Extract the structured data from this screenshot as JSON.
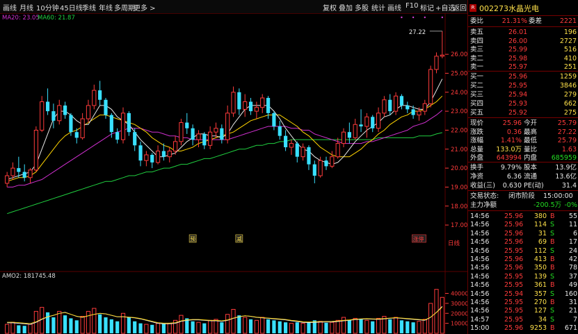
{
  "toolbar": {
    "left": [
      "画线",
      "月线",
      "10分钟",
      "45日线",
      "季线",
      "年线",
      "多周期",
      "更多 >"
    ],
    "right": [
      "复权",
      "叠加",
      "多股",
      "统计",
      "画线",
      "F10",
      "标记",
      "+自选",
      "返回"
    ]
  },
  "indicators": {
    "ma20": "MA20: 23.05",
    "ma60": "MA60: 21.87",
    "vol": "AMO2: 181745.48"
  },
  "price_axis": [
    "26.00",
    "25.00",
    "24.00",
    "23.00",
    "22.00",
    "21.00",
    "20.00",
    "19.00",
    "18.00",
    "17.00"
  ],
  "vol_axis": [
    "40000",
    "30000",
    "20000",
    "10000"
  ],
  "axis_label": "日线",
  "high_label": "27.22",
  "markers": [
    {
      "t": "预",
      "col": "#ffe14a"
    },
    {
      "t": "减",
      "col": "#ffe14a"
    },
    {
      "t": "涨停",
      "col": "#ff3b3b"
    }
  ],
  "chart_data": {
    "type": "candlestick",
    "y_range": [
      16.6,
      27.8
    ],
    "candles": [
      [
        19.2,
        19.8,
        19.0,
        19.6
      ],
      [
        19.6,
        20.3,
        19.4,
        20.0
      ],
      [
        20.0,
        20.6,
        19.5,
        19.8
      ],
      [
        19.8,
        20.2,
        19.3,
        19.5
      ],
      [
        19.5,
        20.0,
        19.2,
        19.9
      ],
      [
        19.9,
        22.2,
        19.8,
        22.0
      ],
      [
        22.0,
        23.8,
        21.9,
        23.5
      ],
      [
        23.5,
        24.2,
        22.8,
        23.0
      ],
      [
        23.0,
        23.4,
        22.1,
        22.5
      ],
      [
        22.5,
        23.6,
        22.3,
        23.3
      ],
      [
        23.3,
        23.5,
        22.6,
        22.8
      ],
      [
        22.8,
        22.9,
        21.7,
        21.9
      ],
      [
        21.9,
        22.1,
        21.3,
        21.6
      ],
      [
        21.6,
        22.9,
        21.5,
        22.6
      ],
      [
        22.6,
        23.6,
        22.4,
        23.3
      ],
      [
        23.3,
        24.4,
        23.1,
        24.1
      ],
      [
        24.1,
        24.6,
        23.3,
        23.6
      ],
      [
        23.6,
        23.7,
        22.6,
        22.8
      ],
      [
        22.8,
        22.9,
        21.6,
        21.9
      ],
      [
        21.9,
        22.1,
        21.3,
        21.5
      ],
      [
        21.5,
        23.2,
        21.3,
        22.9
      ],
      [
        22.9,
        23.0,
        21.7,
        21.9
      ],
      [
        21.9,
        22.1,
        20.9,
        21.2
      ],
      [
        21.2,
        21.4,
        20.1,
        20.4
      ],
      [
        20.4,
        20.9,
        20.1,
        20.7
      ],
      [
        20.7,
        20.8,
        20.0,
        20.3
      ],
      [
        20.3,
        21.2,
        20.2,
        20.9
      ],
      [
        20.9,
        21.3,
        20.4,
        20.6
      ],
      [
        20.6,
        21.1,
        20.3,
        20.9
      ],
      [
        20.9,
        21.7,
        20.7,
        21.4
      ],
      [
        21.4,
        22.6,
        21.2,
        22.4
      ],
      [
        22.4,
        22.9,
        21.8,
        22.1
      ],
      [
        22.1,
        22.3,
        21.2,
        21.5
      ],
      [
        21.5,
        22.0,
        21.1,
        21.8
      ],
      [
        21.8,
        21.9,
        21.0,
        21.2
      ],
      [
        21.2,
        22.2,
        21.0,
        21.9
      ],
      [
        21.9,
        22.4,
        21.6,
        22.1
      ],
      [
        22.1,
        22.3,
        21.3,
        21.5
      ],
      [
        21.5,
        23.3,
        21.3,
        22.9
      ],
      [
        22.9,
        24.3,
        22.7,
        24.0
      ],
      [
        24.0,
        24.2,
        22.8,
        23.1
      ],
      [
        23.1,
        23.9,
        22.7,
        23.5
      ],
      [
        23.5,
        23.7,
        22.8,
        23.0
      ],
      [
        23.0,
        23.5,
        22.6,
        23.2
      ],
      [
        23.2,
        23.9,
        22.9,
        23.7
      ],
      [
        23.7,
        23.8,
        22.6,
        22.9
      ],
      [
        22.9,
        23.0,
        22.0,
        22.2
      ],
      [
        22.2,
        22.5,
        21.5,
        21.7
      ],
      [
        21.7,
        22.0,
        20.9,
        21.1
      ],
      [
        21.1,
        21.5,
        20.7,
        21.3
      ],
      [
        21.3,
        21.4,
        20.3,
        20.6
      ],
      [
        20.6,
        21.3,
        20.4,
        21.1
      ],
      [
        21.1,
        21.2,
        19.9,
        20.2
      ],
      [
        20.2,
        20.4,
        19.2,
        19.6
      ],
      [
        19.6,
        20.6,
        19.5,
        20.4
      ],
      [
        20.4,
        20.6,
        19.9,
        20.1
      ],
      [
        20.1,
        20.9,
        20.0,
        20.6
      ],
      [
        20.6,
        21.6,
        20.5,
        21.3
      ],
      [
        21.3,
        22.1,
        21.1,
        21.9
      ],
      [
        21.9,
        22.4,
        21.3,
        21.6
      ],
      [
        21.6,
        22.6,
        21.5,
        22.3
      ],
      [
        22.3,
        23.1,
        21.9,
        22.2
      ],
      [
        22.2,
        22.9,
        21.6,
        22.7
      ],
      [
        22.7,
        22.8,
        21.9,
        22.1
      ],
      [
        22.1,
        23.2,
        21.9,
        22.9
      ],
      [
        22.9,
        23.8,
        22.7,
        23.6
      ],
      [
        23.6,
        23.9,
        22.8,
        23.0
      ],
      [
        23.0,
        24.0,
        22.8,
        23.8
      ],
      [
        23.8,
        23.9,
        23.1,
        23.3
      ],
      [
        23.3,
        23.5,
        22.9,
        23.1
      ],
      [
        23.1,
        23.3,
        22.6,
        22.8
      ],
      [
        22.8,
        23.2,
        22.5,
        23.0
      ],
      [
        23.0,
        23.6,
        22.8,
        23.4
      ],
      [
        23.4,
        25.4,
        23.2,
        25.2
      ],
      [
        25.2,
        26.1,
        25.0,
        25.9
      ],
      [
        25.9,
        27.22,
        25.79,
        25.96
      ]
    ],
    "ma_lines": {
      "ma5": [
        19.4,
        19.5,
        19.6,
        19.7,
        19.8,
        20.2,
        21.0,
        21.8,
        22.6,
        23.0,
        23.0,
        22.8,
        22.5,
        22.3,
        22.3,
        22.8,
        23.3,
        23.3,
        23.1,
        22.7,
        22.5,
        22.3,
        21.9,
        21.5,
        21.2,
        20.9,
        20.6,
        20.6,
        20.7,
        20.8,
        21.1,
        21.4,
        21.6,
        21.8,
        21.8,
        21.7,
        21.7,
        21.6,
        21.8,
        22.3,
        22.7,
        23.1,
        23.3,
        23.3,
        23.3,
        23.3,
        23.0,
        22.6,
        22.1,
        21.7,
        21.3,
        21.0,
        20.9,
        20.6,
        20.4,
        20.3,
        20.2,
        20.3,
        20.6,
        21.0,
        21.4,
        21.7,
        22.0,
        22.2,
        22.4,
        22.7,
        22.8,
        23.1,
        23.3,
        23.3,
        23.2,
        23.1,
        23.1,
        23.5,
        24.1,
        24.7
      ],
      "ma10": [
        19.3,
        19.4,
        19.5,
        19.5,
        19.6,
        19.8,
        20.2,
        20.6,
        21.0,
        21.4,
        21.7,
        21.9,
        22.0,
        22.2,
        22.4,
        22.6,
        22.8,
        22.8,
        22.7,
        22.6,
        22.5,
        22.4,
        22.3,
        22.1,
        21.9,
        21.6,
        21.4,
        21.2,
        21.1,
        20.9,
        20.9,
        21.0,
        21.1,
        21.3,
        21.4,
        21.5,
        21.6,
        21.7,
        21.8,
        21.9,
        22.1,
        22.3,
        22.5,
        22.6,
        22.7,
        22.8,
        22.8,
        22.8,
        22.6,
        22.4,
        22.2,
        21.9,
        21.7,
        21.4,
        21.1,
        20.9,
        20.7,
        20.6,
        20.6,
        20.6,
        20.8,
        21.0,
        21.3,
        21.5,
        21.8,
        22.0,
        22.3,
        22.5,
        22.7,
        22.8,
        23.0,
        23.0,
        23.1,
        23.3,
        23.5,
        23.8
      ],
      "ma20": [
        19.0,
        19.0,
        19.1,
        19.1,
        19.2,
        19.3,
        19.4,
        19.6,
        19.8,
        20.0,
        20.2,
        20.4,
        20.6,
        20.8,
        21.0,
        21.2,
        21.4,
        21.6,
        21.8,
        21.9,
        22.0,
        22.1,
        22.1,
        22.1,
        22.0,
        21.9,
        21.9,
        21.8,
        21.7,
        21.7,
        21.6,
        21.6,
        21.5,
        21.5,
        21.5,
        21.5,
        21.5,
        21.5,
        21.5,
        21.6,
        21.7,
        21.8,
        21.9,
        22.0,
        22.1,
        22.2,
        22.2,
        22.2,
        22.2,
        22.1,
        22.1,
        22.0,
        22.0,
        21.8,
        21.7,
        21.6,
        21.5,
        21.4,
        21.3,
        21.3,
        21.3,
        21.3,
        21.4,
        21.4,
        21.5,
        21.6,
        21.7,
        21.8,
        21.9,
        22.0,
        22.2,
        22.3,
        22.4,
        22.6,
        22.8,
        23.05
      ],
      "ma60": [
        17.6,
        17.7,
        17.8,
        17.9,
        18.0,
        18.1,
        18.2,
        18.3,
        18.4,
        18.5,
        18.6,
        18.7,
        18.8,
        18.9,
        19.0,
        19.1,
        19.2,
        19.3,
        19.3,
        19.4,
        19.5,
        19.6,
        19.6,
        19.7,
        19.8,
        19.8,
        19.9,
        20.0,
        20.0,
        20.1,
        20.2,
        20.2,
        20.3,
        20.4,
        20.5,
        20.5,
        20.6,
        20.7,
        20.8,
        20.9,
        21.0,
        21.0,
        21.1,
        21.2,
        21.2,
        21.3,
        21.3,
        21.4,
        21.4,
        21.5,
        21.5,
        21.5,
        21.5,
        21.5,
        21.5,
        21.5,
        21.5,
        21.5,
        21.5,
        21.5,
        21.5,
        21.5,
        21.5,
        21.5,
        21.6,
        21.6,
        21.6,
        21.6,
        21.6,
        21.6,
        21.6,
        21.7,
        21.7,
        21.7,
        21.8,
        21.87
      ]
    },
    "volume": [
      9000,
      11000,
      8000,
      7500,
      9000,
      22000,
      26000,
      21000,
      16000,
      22000,
      18000,
      15000,
      13000,
      17000,
      22000,
      25000,
      19000,
      16000,
      14000,
      12000,
      20000,
      16000,
      12000,
      10000,
      9000,
      8500,
      10000,
      9500,
      10000,
      13000,
      18000,
      15000,
      12000,
      11000,
      10000,
      13000,
      14000,
      11000,
      19000,
      24000,
      18000,
      16000,
      14000,
      13000,
      16000,
      14000,
      13000,
      12000,
      11000,
      10000,
      11000,
      10000,
      11000,
      13000,
      12000,
      10500,
      11000,
      13000,
      16000,
      13000,
      15000,
      14000,
      13000,
      12000,
      15000,
      17000,
      14000,
      16000,
      13000,
      12000,
      11000,
      12000,
      14000,
      30000,
      44000,
      36000
    ],
    "vol_range": [
      0,
      48000
    ],
    "vol_ma": [
      10500,
      10500,
      10000,
      9500,
      9000,
      11000,
      14000,
      16500,
      18000,
      20000,
      21000,
      19000,
      17000,
      16000,
      17500,
      19000,
      20000,
      19500,
      18000,
      16500,
      16500,
      16000,
      15500,
      14500,
      13000,
      11500,
      10000,
      9500,
      9500,
      10000,
      12000,
      13000,
      13500,
      13500,
      13000,
      12500,
      12500,
      12000,
      13000,
      15000,
      16500,
      17500,
      17000,
      16000,
      15500,
      15000,
      14500,
      14000,
      13500,
      12500,
      11800,
      11000,
      10800,
      11000,
      11200,
      11300,
      11400,
      11800,
      12500,
      13000,
      13800,
      14200,
      14400,
      14200,
      14000,
      14500,
      15000,
      15500,
      15000,
      14500,
      14000,
      13500,
      13000,
      16000,
      21000,
      27000
    ]
  },
  "panel": {
    "code": "002273",
    "name": "水晶光电",
    "webi_label": "委比",
    "webi": "21.31%",
    "weicha_label": "委差",
    "weicha": "2221",
    "sells": [
      {
        "l": "卖五",
        "p": "26.01",
        "v": "196"
      },
      {
        "l": "卖四",
        "p": "26.00",
        "v": "2727"
      },
      {
        "l": "卖三",
        "p": "25.99",
        "v": "516"
      },
      {
        "l": "卖二",
        "p": "25.98",
        "v": "410"
      },
      {
        "l": "卖一",
        "p": "25.97",
        "v": "251"
      }
    ],
    "buys": [
      {
        "l": "买一",
        "p": "25.96",
        "v": "1259"
      },
      {
        "l": "买二",
        "p": "25.95",
        "v": "3846"
      },
      {
        "l": "买三",
        "p": "25.94",
        "v": "279"
      },
      {
        "l": "买四",
        "p": "25.93",
        "v": "662"
      },
      {
        "l": "买五",
        "p": "25.92",
        "v": "275"
      }
    ],
    "stats": [
      {
        "a": "现价",
        "av": "25.96",
        "ac": "red",
        "b": "今开",
        "bv": "25.79",
        "bc": "red"
      },
      {
        "a": "涨跌",
        "av": "0.36",
        "ac": "red",
        "b": "最高",
        "bv": "27.22",
        "bc": "red"
      },
      {
        "a": "涨幅",
        "av": "1.41%",
        "ac": "red",
        "b": "最低",
        "bv": "25.79",
        "bc": "red"
      },
      {
        "a": "总量",
        "av": "133.0万",
        "ac": "yel",
        "b": "量比",
        "bv": "1.63",
        "bc": "red"
      },
      {
        "a": "外盘",
        "av": "643994",
        "ac": "red",
        "b": "内盘",
        "bv": "685959",
        "bc": "grn"
      }
    ],
    "stats2": [
      {
        "a": "换手",
        "av": "9.79%",
        "b": "股本",
        "bv": "13.9亿"
      },
      {
        "a": "净资",
        "av": "6.36",
        "b": "流通",
        "bv": "13.6亿"
      },
      {
        "a": "收益(三)",
        "av": "0.630",
        "b": "PE(动)",
        "bv": "31.4"
      }
    ],
    "status_label": "交易状态:",
    "status": "闭市阶段",
    "status_time": "15:00:00",
    "mainflow_label": "主力净额",
    "mainflow": "-200.5万",
    "mainflow_pct": "-0%",
    "ticks": [
      {
        "t": "14:56",
        "p": "25.96",
        "v": "380",
        "s": "B",
        "n": "55"
      },
      {
        "t": "14:56",
        "p": "25.96",
        "v": "114",
        "s": "S",
        "n": "11"
      },
      {
        "t": "14:56",
        "p": "25.96",
        "v": "31",
        "s": "S",
        "n": "6"
      },
      {
        "t": "14:56",
        "p": "25.96",
        "v": "69",
        "s": "B",
        "n": "17"
      },
      {
        "t": "14:56",
        "p": "25.95",
        "v": "112",
        "s": "S",
        "n": "24"
      },
      {
        "t": "14:56",
        "p": "25.96",
        "v": "413",
        "s": "B",
        "n": "42"
      },
      {
        "t": "14:56",
        "p": "25.96",
        "v": "350",
        "s": "B",
        "n": "78"
      },
      {
        "t": "14:56",
        "p": "25.95",
        "v": "139",
        "s": "S",
        "n": "37"
      },
      {
        "t": "14:56",
        "p": "25.95",
        "v": "361",
        "s": "B",
        "n": "49"
      },
      {
        "t": "14:56",
        "p": "25.94",
        "v": "357",
        "s": "S",
        "n": "160"
      },
      {
        "t": "14:56",
        "p": "25.95",
        "v": "270",
        "s": "B",
        "n": "31"
      },
      {
        "t": "14:56",
        "p": "25.95",
        "v": "127",
        "s": "S",
        "n": "21"
      },
      {
        "t": "14:57",
        "p": "25.95",
        "v": "34",
        "s": "S",
        "n": "7"
      },
      {
        "t": "15:00",
        "p": "25.96",
        "v": "9253",
        "s": "B",
        "n": "671"
      }
    ]
  },
  "colors": {
    "up": "#ff3b3b",
    "down": "#39e0ff",
    "ma5": "#e8e8e8",
    "ma10": "#ffd400",
    "ma20": "#d030d0",
    "ma60": "#20d040",
    "grid": "#5a0000"
  }
}
